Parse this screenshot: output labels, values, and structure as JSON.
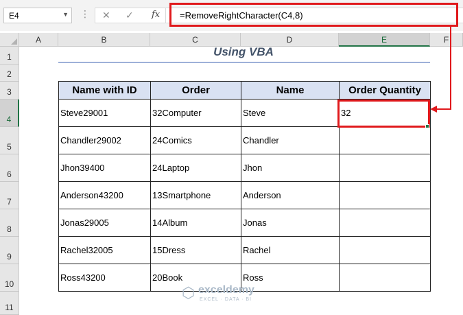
{
  "formula_bar": {
    "name_box": "E4",
    "name_box_arrow": "▼",
    "dots": "⋮",
    "cancel_glyph": "✕",
    "enter_glyph": "✓",
    "fx_label": "fx",
    "formula": "=RemoveRightCharacter(C4,8)"
  },
  "columns": [
    "A",
    "B",
    "C",
    "D",
    "E",
    "F"
  ],
  "rows": [
    "1",
    "2",
    "3",
    "4",
    "5",
    "6",
    "7",
    "8",
    "9",
    "10",
    "11"
  ],
  "selected_cell": "E4",
  "sheet": {
    "title": "Using VBA",
    "headers": [
      "Name with ID",
      "Order",
      "Name",
      "Order Quantity"
    ],
    "records": [
      [
        "Steve29001",
        "32Computer",
        "Steve",
        "32"
      ],
      [
        "Chandler29002",
        "24Comics",
        "Chandler",
        ""
      ],
      [
        "Jhon39400",
        "24Laptop",
        "Jhon",
        ""
      ],
      [
        "Anderson43200",
        "13Smartphone",
        "Anderson",
        ""
      ],
      [
        "Jonas29005",
        "14Album",
        "Jonas",
        ""
      ],
      [
        "Rachel32005",
        "15Dress",
        "Rachel",
        ""
      ],
      [
        "Ross43200",
        "20Book",
        "Ross",
        ""
      ]
    ]
  },
  "watermark": {
    "name": "exceldemy",
    "tagline": "EXCEL · DATA · BI"
  },
  "colors": {
    "highlight": "#e0191c",
    "header_fill": "#d9e1f2",
    "title_text": "#44546a",
    "selection": "#217346"
  }
}
